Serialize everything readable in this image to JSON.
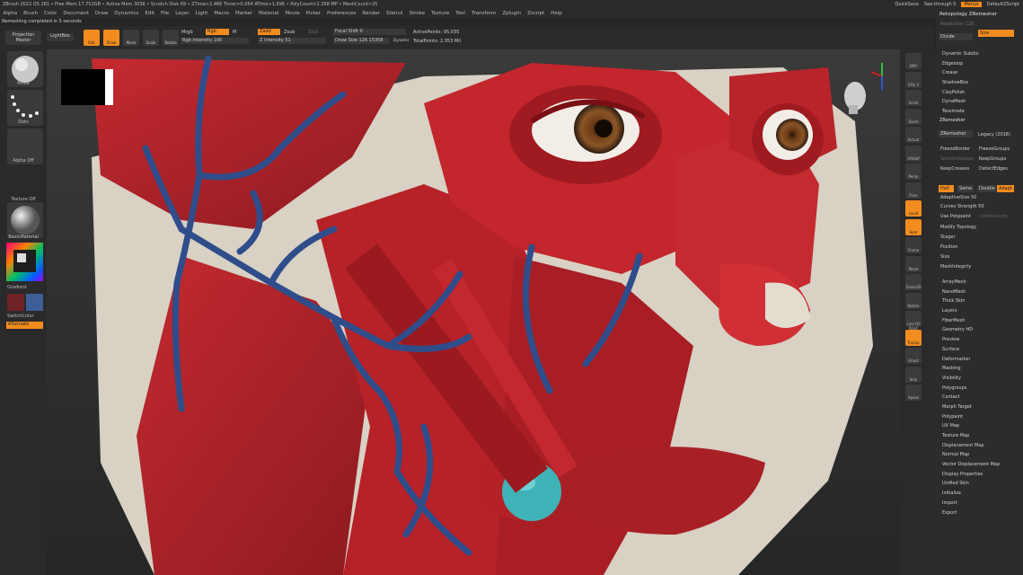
{
  "topbar": {
    "info": "ZBrush 2022  QS 281  • Free Mem 17.752GB • Active Mem 3036 • Scratch Disk 69 • ZTime>2.466 Timer>0.054 ATime>1.696 • PolyCount>2.358 MP • MeshCount>25",
    "quicksave": "QuickSave",
    "see_through": "See-through  0",
    "menus": "Menus",
    "script": "DefaultZScript"
  },
  "menus": [
    "Alpha",
    "Brush",
    "Color",
    "Document",
    "Draw",
    "Dynamics",
    "Edit",
    "File",
    "Layer",
    "Light",
    "Macro",
    "Marker",
    "Material",
    "Movie",
    "Picker",
    "Preferences",
    "Render",
    "Stencil",
    "Stroke",
    "Texture",
    "Tool",
    "Transform",
    "Zplugin",
    "Zscript",
    "Help"
  ],
  "notice": "Remeshing completed in 5 seconds",
  "toolbar": {
    "projection_master": "Projection Master",
    "lightbox": "LightBox",
    "edit": "Edit",
    "draw": "Draw",
    "move": "Move",
    "scale": "Scale",
    "rotate": "Rotate",
    "mrgb": "Mrgb",
    "rgb": "Rgb",
    "m": "M",
    "zadd": "Zadd",
    "zsub": "Zsub",
    "zcut": "Zcut",
    "rgb_intensity": "Rgb Intensity 100",
    "z_intensity": "Z Intensity 51",
    "focal_shift": "Focal Shift 0",
    "draw_size": "Draw Size 126.15358",
    "dynamic": "Dynamic",
    "active_points": "ActivePoints: 95,035",
    "total_points": "TotalPoints: 2.353 Mil"
  },
  "leftshelf": {
    "brush": "Move",
    "stroke": "Dots",
    "alpha": "Alpha Off",
    "texture": "Texture Off",
    "material": "BasicMaterial",
    "gradient": "Gradient",
    "switch_color": "SwitchColor",
    "alternate": "Alternate"
  },
  "rightshelf": [
    "BPR",
    "SPix 3",
    "Scroll",
    "Zoom",
    "Actual",
    "AAHalf",
    "Persp",
    "Floor",
    "Local",
    "Sym",
    "Frame",
    "Move",
    "Zoom3D",
    "Rotate",
    "Line Fill PolyF",
    "Transp",
    "Ghost",
    "Solo",
    "Xpose"
  ],
  "palette": {
    "title": "Retopology ZRemesher",
    "dynamesh": "DynaMesh",
    "resolution_hint": "Resolution 128",
    "divide": "Divide",
    "size": "Size",
    "sub_items": [
      "Dynamic Subdiv",
      "Edgeloop",
      "Crease",
      "ShadowBox",
      "ClayPolish",
      "DynaMesh",
      "Tessimate"
    ],
    "zremesher": "ZRemesher",
    "zremesher_btn": "ZRemesher",
    "legacy": "Legacy (2018)",
    "freeze_border": "FreezeBorder",
    "freeze_groups": "FreezeGroups",
    "smooth_groups": "SmoothGroups",
    "keep_groups": "KeepGroups",
    "keep_creases": "KeepCreases",
    "detect_edges": "DetectEdges",
    "half": "Half",
    "same": "Same",
    "double": "Double",
    "adapt": "Adapt",
    "adaptive_size": "AdaptiveSize 50",
    "curves_strength": "Curves Strength 50",
    "use_polypaint": "Use Polypaint",
    "color_density": "ColorDensity",
    "modify_topology": "Modify Topology",
    "stager": "Stager",
    "position": "Position",
    "size2": "Size",
    "mesh_integrity": "MeshIntegrity",
    "list": [
      "ArrayMesh",
      "NanoMesh",
      "Thick Skin",
      "Layers",
      "FiberMesh",
      "Geometry HD",
      "Preview",
      "Surface",
      "Deformation",
      "Masking",
      "Visibility",
      "Polygroups",
      "Contact",
      "Morph Target",
      "Polypaint",
      "UV Map",
      "Texture Map",
      "Displacement Map",
      "Normal Map",
      "Vector Displacement Map",
      "Display Properties",
      "Unified Skin",
      "Initialize",
      "Import",
      "Export"
    ]
  },
  "colors": {
    "accent": "#f28c1e",
    "muscle": "#b8232a",
    "vein": "#2f4d8a",
    "bone": "#d9d3c6",
    "gland": "#3fb3b8"
  }
}
